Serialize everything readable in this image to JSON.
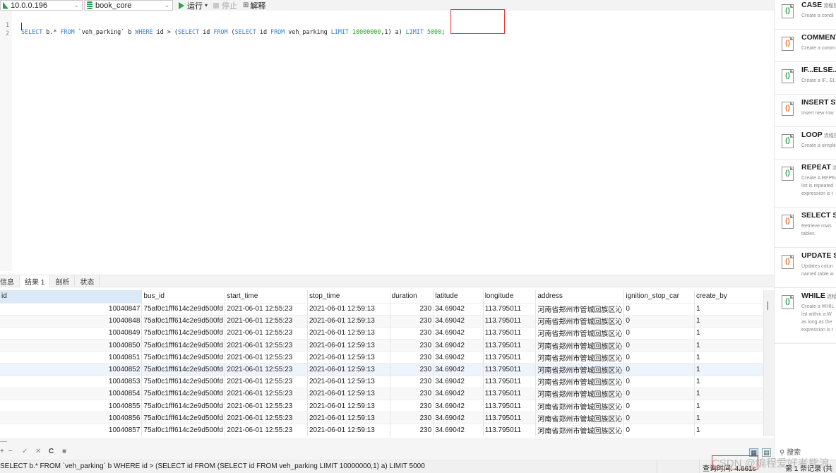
{
  "toolbar": {
    "connection": "10.0.0.196",
    "database": "book_core",
    "run_label": "运行",
    "stop_label": "停止",
    "explain_label": "解释"
  },
  "editor": {
    "line_numbers": [
      "1",
      "2"
    ],
    "query_tokens": [
      {
        "t": "SELECT",
        "k": "kw"
      },
      {
        "t": " b.* ",
        "k": ""
      },
      {
        "t": "FROM",
        "k": "kw"
      },
      {
        "t": " `veh_parking` b ",
        "k": ""
      },
      {
        "t": "WHERE",
        "k": "kw"
      },
      {
        "t": " id > (",
        "k": ""
      },
      {
        "t": "SELECT",
        "k": "kw"
      },
      {
        "t": " id ",
        "k": ""
      },
      {
        "t": "FROM",
        "k": "kw"
      },
      {
        "t": " (",
        "k": ""
      },
      {
        "t": "SELECT",
        "k": "kw"
      },
      {
        "t": " id ",
        "k": ""
      },
      {
        "t": "FROM",
        "k": "kw"
      },
      {
        "t": " veh_parking ",
        "k": ""
      },
      {
        "t": "LIMIT",
        "k": "kw"
      },
      {
        "t": " ",
        "k": ""
      },
      {
        "t": "10000000",
        "k": "num"
      },
      {
        "t": ",1) a) ",
        "k": ""
      },
      {
        "t": "LIMIT",
        "k": "kw"
      },
      {
        "t": " ",
        "k": ""
      },
      {
        "t": "5000",
        "k": "num"
      },
      {
        "t": ";",
        "k": ""
      }
    ]
  },
  "result_tabs": [
    "信息",
    "结果 1",
    "剖析",
    "状态"
  ],
  "active_tab": "结果 1",
  "grid": {
    "columns": [
      "id",
      "bus_id",
      "start_time",
      "stop_time",
      "duration",
      "latitude",
      "longitude",
      "address",
      "ignition_stop_car",
      "create_by"
    ],
    "rows": [
      [
        "10040847",
        "75af0c1fff614c2e9d500fd",
        "2021-06-01 12:55:23",
        "2021-06-01 12:59:13",
        "230",
        "34.69042",
        "113.795011",
        "河南省郑州市管城回族区沁",
        "0",
        "1"
      ],
      [
        "10040848",
        "75af0c1fff614c2e9d500fd",
        "2021-06-01 12:55:23",
        "2021-06-01 12:59:13",
        "230",
        "34.69042",
        "113.795011",
        "河南省郑州市管城回族区沁",
        "0",
        "1"
      ],
      [
        "10040849",
        "75af0c1fff614c2e9d500fd",
        "2021-06-01 12:55:23",
        "2021-06-01 12:59:13",
        "230",
        "34.69042",
        "113.795011",
        "河南省郑州市管城回族区沁",
        "0",
        "1"
      ],
      [
        "10040850",
        "75af0c1fff614c2e9d500fd",
        "2021-06-01 12:55:23",
        "2021-06-01 12:59:13",
        "230",
        "34.69042",
        "113.795011",
        "河南省郑州市管城回族区沁",
        "0",
        "1"
      ],
      [
        "10040851",
        "75af0c1fff614c2e9d500fd",
        "2021-06-01 12:55:23",
        "2021-06-01 12:59:13",
        "230",
        "34.69042",
        "113.795011",
        "河南省郑州市管城回族区沁",
        "0",
        "1"
      ],
      [
        "10040852",
        "75af0c1fff614c2e9d500fd",
        "2021-06-01 12:55:23",
        "2021-06-01 12:59:13",
        "230",
        "34.69042",
        "113.795011",
        "河南省郑州市管城回族区沁",
        "0",
        "1"
      ],
      [
        "10040853",
        "75af0c1fff614c2e9d500fd",
        "2021-06-01 12:55:23",
        "2021-06-01 12:59:13",
        "230",
        "34.69042",
        "113.795011",
        "河南省郑州市管城回族区沁",
        "0",
        "1"
      ],
      [
        "10040854",
        "75af0c1fff614c2e9d500fd",
        "2021-06-01 12:55:23",
        "2021-06-01 12:59:13",
        "230",
        "34.69042",
        "113.795011",
        "河南省郑州市管城回族区沁",
        "0",
        "1"
      ],
      [
        "10040855",
        "75af0c1fff614c2e9d500fd",
        "2021-06-01 12:55:23",
        "2021-06-01 12:59:13",
        "230",
        "34.69042",
        "113.795011",
        "河南省郑州市管城回族区沁",
        "0",
        "1"
      ],
      [
        "10040856",
        "75af0c1fff614c2e9d500fd",
        "2021-06-01 12:55:23",
        "2021-06-01 12:59:13",
        "230",
        "34.69042",
        "113.795011",
        "河南省郑州市管城回族区沁",
        "0",
        "1"
      ],
      [
        "10040857",
        "75af0c1fff614c2e9d500fd",
        "2021-06-01 12:55:23",
        "2021-06-01 12:59:13",
        "230",
        "34.69042",
        "113.795011",
        "河南省郑州市管城回族区沁",
        "0",
        "1"
      ]
    ]
  },
  "bottom_tools": [
    "−",
    "✓",
    "✕",
    "C",
    "■"
  ],
  "status": {
    "sql": "SELECT b.* FROM `veh_parking` b WHERE id > (SELECT id FROM (SELECT id FROM veh_parking LIMIT 10000000,1) a) LIMIT 5000",
    "query_time": "查询时间: 4.661s",
    "record": "第 1 条记录 (共",
    "watermark": "CSDN @编程爱好者熊浪"
  },
  "snippets": [
    {
      "title": "CASE",
      "tag": "流程控",
      "desc": "Create a condi",
      "icon": "green"
    },
    {
      "title": "COMMENT",
      "tag": "",
      "desc": "Create a comm",
      "icon": "multi"
    },
    {
      "title": "IF...ELSE...",
      "tag": "",
      "desc": "Create a IF...EL",
      "icon": "green"
    },
    {
      "title": "INSERT Sy",
      "tag": "",
      "desc": "Insert new row",
      "icon": "multi"
    },
    {
      "title": "LOOP",
      "tag": "流程控",
      "desc": "Create a simple",
      "icon": "green"
    },
    {
      "title": "REPEAT",
      "tag": "流程",
      "desc": "Create A REPEA\nlist is repeated\nexpression is t",
      "icon": "green"
    },
    {
      "title": "SELECT Sy",
      "tag": "",
      "desc": "Retrieve rows\ntables",
      "icon": "multi"
    },
    {
      "title": "UPDATE S",
      "tag": "",
      "desc": "Updates colun\nnamed table w",
      "icon": "multi"
    },
    {
      "title": "WHILE",
      "tag": "流程",
      "desc": "Create a WHIL\nlist within a W\nas long as the\nexpression is t",
      "icon": "green"
    }
  ],
  "search_label": "搜索"
}
